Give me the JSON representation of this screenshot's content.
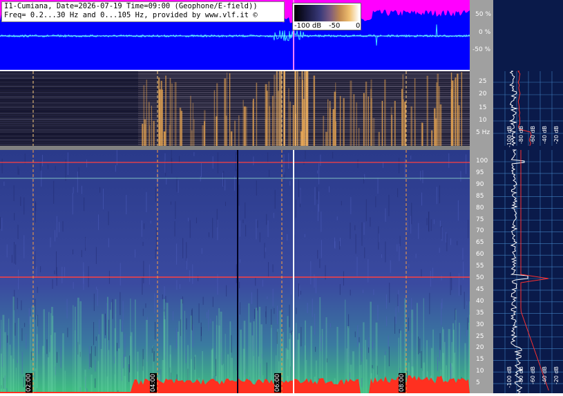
{
  "header": {
    "title_line1": "I1-Cumiana, Date=2026-07-19 Time=09:00 (Geophone/E-field))",
    "title_line2": "Freq= 0.2...30 Hz and 0...105 Hz, provided by www.vlf.it ©"
  },
  "legend": {
    "label_low": "-100 dB",
    "label_mid": "-50",
    "label_high": "0"
  },
  "waveform_axis": {
    "ticks": [
      "50 %",
      "0 %",
      "-50 %"
    ]
  },
  "low_freq_axis": {
    "ticks": [
      "25",
      "20",
      "15",
      "10",
      "5 Hz"
    ]
  },
  "high_freq_axis": {
    "ticks": [
      "100",
      "95",
      "90",
      "85",
      "80",
      "75",
      "70",
      "65",
      "60",
      "55",
      "50",
      "45",
      "40",
      "35",
      "30",
      "25",
      "20",
      "15",
      "10",
      "5"
    ]
  },
  "time_axis": {
    "labels": [
      "02:00",
      "04:00",
      "06:00",
      "08:00"
    ]
  },
  "side_spectrum_upper": {
    "labels": [
      "-100 dB",
      "-80 dB",
      "-60 dB",
      "-40 dB",
      "-20 dB"
    ]
  },
  "side_spectrum_lower": {
    "labels": [
      "-100 dB",
      "-80 dB",
      "-60 dB",
      "-40 dB",
      "-20 dB"
    ]
  },
  "colors": {
    "waveform_bg": "#0000ff",
    "magenta": "#ff00ff",
    "axis_bg": "#a0a0a0",
    "side_bg": "#0a1a4a",
    "marker_line": "#ff4040"
  }
}
